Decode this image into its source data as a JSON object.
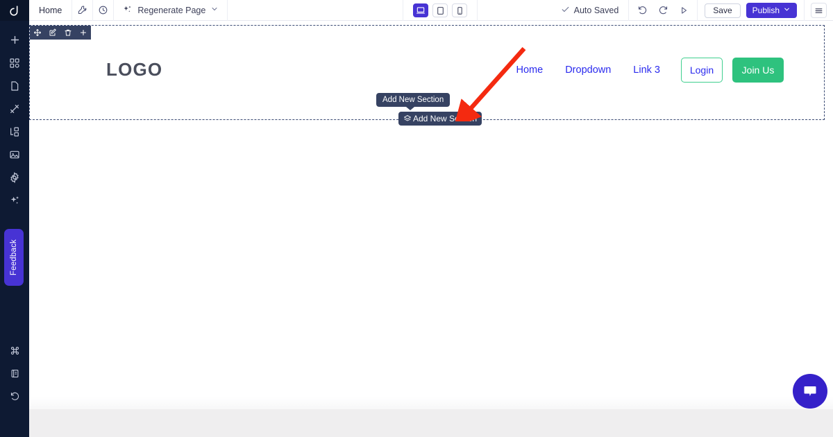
{
  "brand": {
    "logo_icon": "dorik-d-logo"
  },
  "sidebar": {
    "top_items": [
      {
        "label": "Add Element",
        "icon": "plus-icon"
      },
      {
        "label": "Sections",
        "icon": "grid-blocks-icon"
      },
      {
        "label": "Pages",
        "icon": "page-icon"
      },
      {
        "label": "Style",
        "icon": "magic-wand-icon"
      },
      {
        "label": "Layers",
        "icon": "sitemap-icon"
      },
      {
        "label": "Media",
        "icon": "image-icon"
      },
      {
        "label": "Settings",
        "icon": "gear-icon"
      },
      {
        "label": "AI Tools",
        "icon": "sparkles-icon"
      }
    ],
    "feedback_label": "Feedback",
    "bottom_items": [
      {
        "label": "Shortcuts",
        "icon": "command-icon"
      },
      {
        "label": "Docs",
        "icon": "book-icon"
      },
      {
        "label": "History",
        "icon": "history-clock-icon"
      }
    ]
  },
  "toolbar": {
    "page_name": "Home",
    "wrench_icon": "wrench-icon",
    "clock_icon": "clock-icon",
    "regenerate_label": "Regenerate Page",
    "regenerate_icon": "sparkles-icon",
    "regenerate_chevron": "chevron-down-icon",
    "devices": [
      {
        "name": "desktop",
        "icon": "desktop-icon",
        "active": true
      },
      {
        "name": "tablet",
        "icon": "tablet-icon",
        "active": false
      },
      {
        "name": "mobile",
        "icon": "mobile-icon",
        "active": false
      }
    ],
    "autosave_label": "Auto Saved",
    "autosave_icon": "check-icon",
    "undo_icon": "undo-icon",
    "redo_icon": "redo-icon",
    "preview_icon": "play-triangle-icon",
    "save_label": "Save",
    "publish_label": "Publish",
    "publish_chevron": "chevron-down-icon",
    "menu_icon": "hamburger-icon",
    "accent_color": "#4733d4"
  },
  "section_toolbar": {
    "items": [
      {
        "label": "Move Section",
        "icon": "move-arrows-icon"
      },
      {
        "label": "Edit Section",
        "icon": "pencil-square-icon"
      },
      {
        "label": "Delete Section",
        "icon": "trash-icon"
      },
      {
        "label": "Add Section",
        "icon": "plus-icon"
      }
    ],
    "background_color": "#364262"
  },
  "canvas": {
    "navbar": {
      "logo_text": "LOGO",
      "links": [
        {
          "label": "Home"
        },
        {
          "label": "Dropdown"
        },
        {
          "label": "Link 3"
        }
      ],
      "login_label": "Login",
      "join_label": "Join Us",
      "link_color": "#2a2aee",
      "login_border_color": "#3ecf8e",
      "join_bg_color": "#2ec27e"
    },
    "add_section_tooltip": "Add New Section",
    "add_section_button": {
      "label": "Add New Section",
      "icon": "layers-stack-icon"
    },
    "annotation": {
      "type": "arrow",
      "color": "#f42a10",
      "points_to": "add-new-section-button"
    },
    "chat_widget": {
      "icon": "chat-bubble-icon",
      "color": "#3521c9"
    }
  }
}
